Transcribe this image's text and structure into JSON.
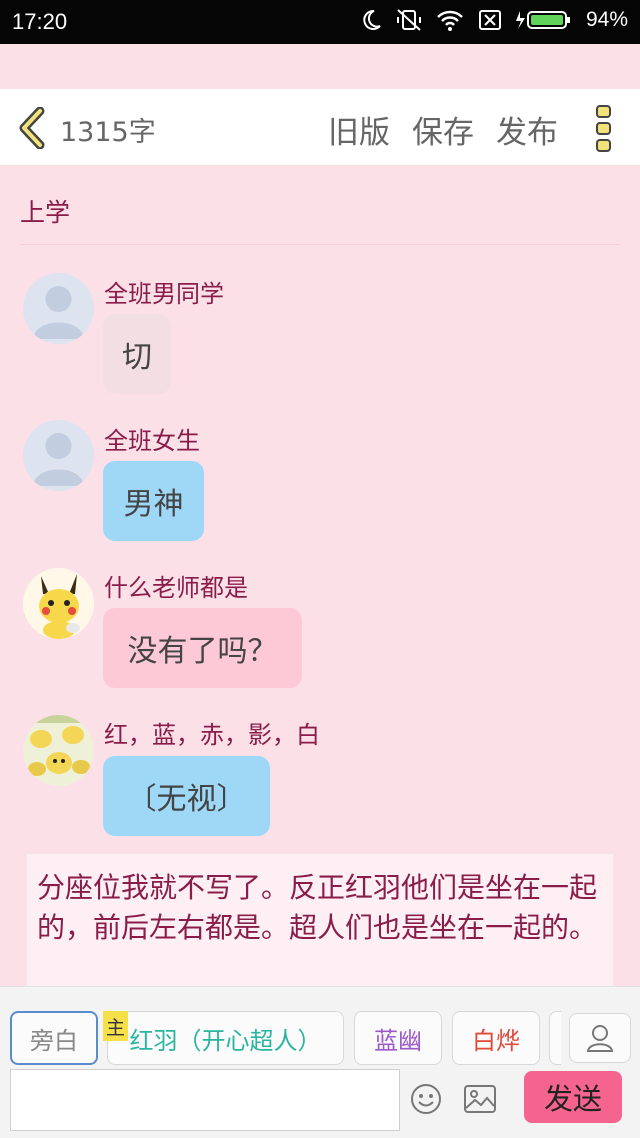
{
  "status_bar": {
    "time": "17:20",
    "battery_percent": "94%",
    "battery_level": 0.94
  },
  "header": {
    "word_count": "1315字",
    "old_version_label": "旧版",
    "save_label": "保存",
    "publish_label": "发布"
  },
  "story": {
    "title": "上学"
  },
  "messages": [
    {
      "name": "全班男同学",
      "text": "切",
      "bubble_color": "#f3dfe3",
      "avatar": "default"
    },
    {
      "name": "全班女生",
      "text": "男神",
      "bubble_color": "#9fd8f7",
      "avatar": "default"
    },
    {
      "name": "什么老师都是",
      "text": "没有了吗？",
      "bubble_color": "#fdc9d6",
      "avatar": "pikachu"
    },
    {
      "name": "红，蓝，赤，影，白",
      "text": "〔无视〕",
      "bubble_color": "#9fd8f7",
      "avatar": "pikachu-group"
    }
  ],
  "narration": {
    "text": "分座位我就不写了。反正红羽他们是坐在一起的，前后左右都是。超人们也是坐在一起的。"
  },
  "characters": [
    {
      "label": "旁白",
      "color": "#888888",
      "selected": true
    },
    {
      "label": "红羽（开心超人）",
      "color": "#2bb5a0",
      "badge": "主"
    },
    {
      "label": "蓝幽",
      "color": "#9b59c9"
    },
    {
      "label": "白烨",
      "color": "#e04a3a"
    }
  ],
  "composer": {
    "input_value": "",
    "send_label": "发送"
  },
  "colors": {
    "accent": "#f4648e",
    "name_color": "#8a1c4a",
    "icon_yellow": "#f2e27a"
  }
}
